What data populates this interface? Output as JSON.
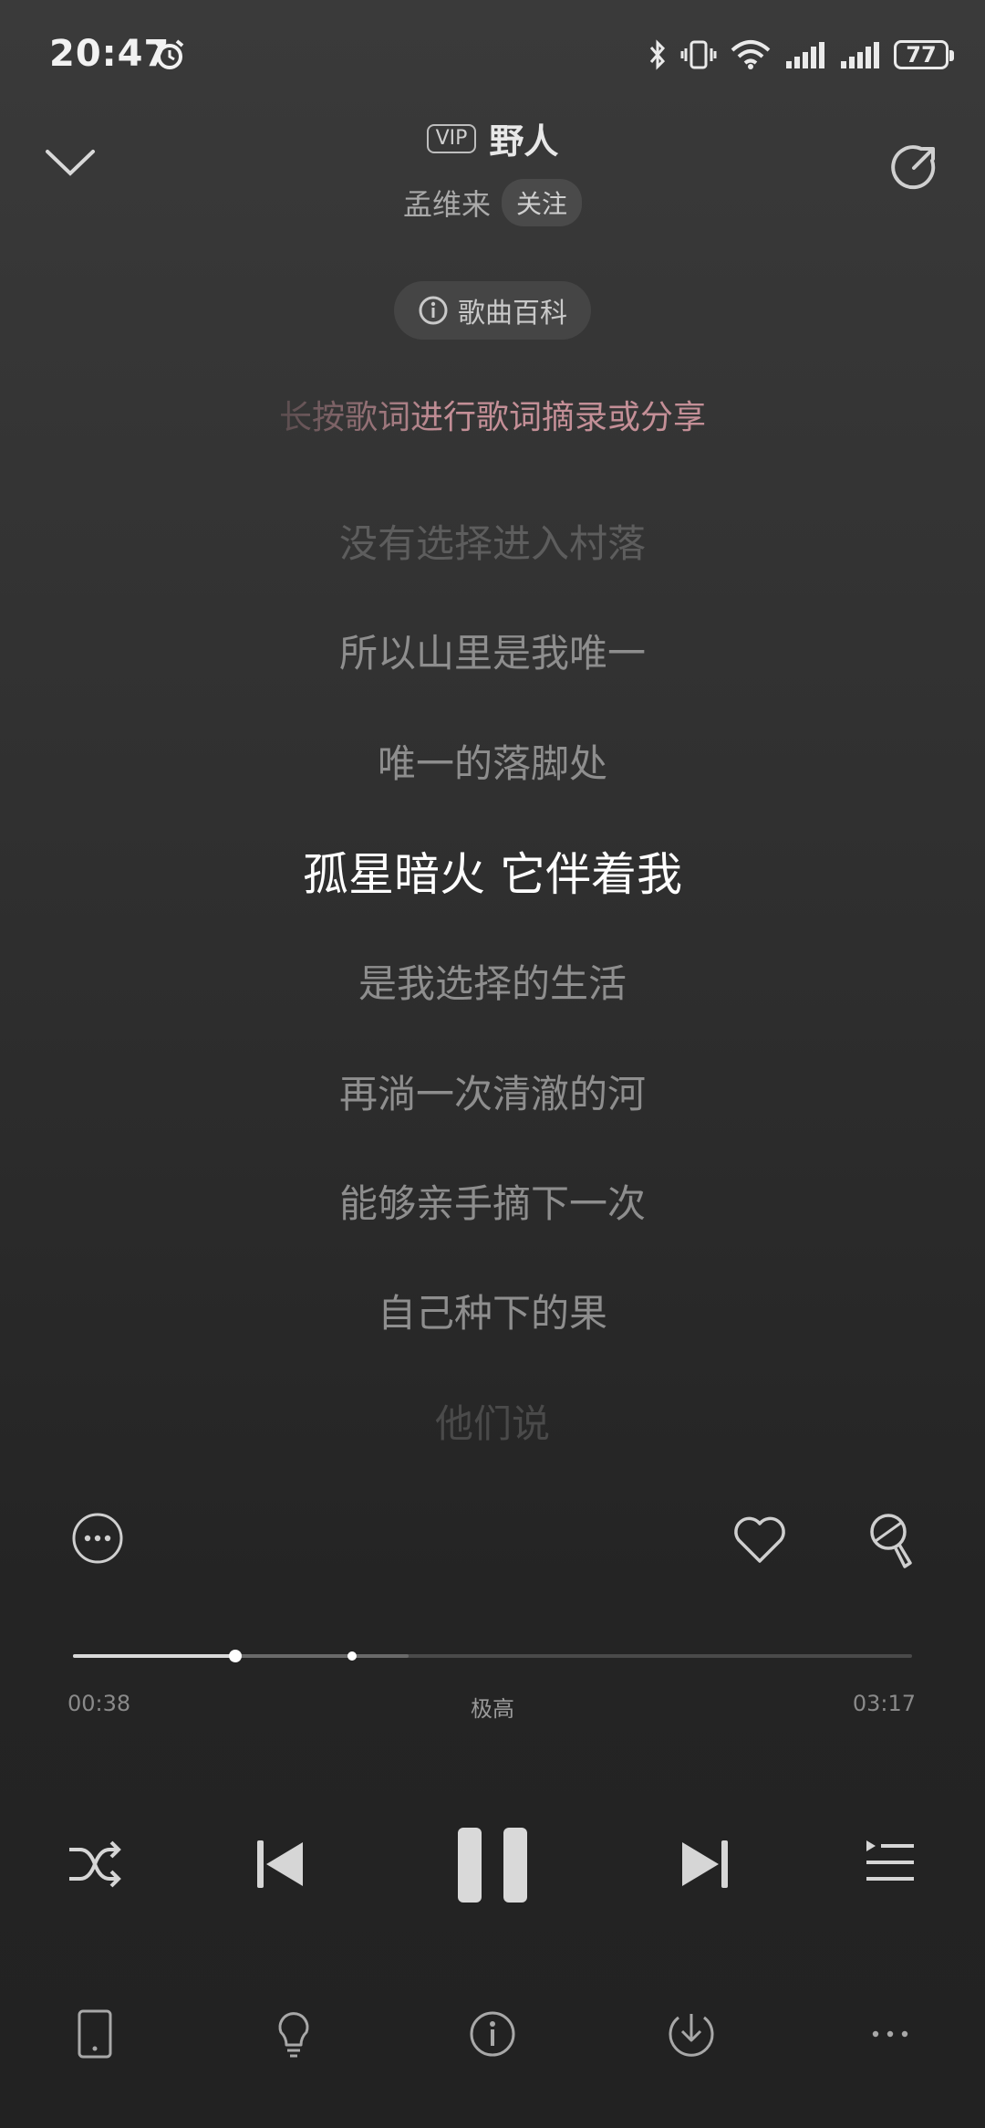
{
  "status_bar": {
    "time": "20:47",
    "battery": "77",
    "icons": [
      "alarm-icon",
      "bluetooth-icon",
      "vibrate-icon",
      "wifi-icon",
      "signal-icon",
      "signal-icon",
      "battery-icon"
    ]
  },
  "header": {
    "vip_badge": "VIP",
    "title": "野人",
    "artist": "孟维来",
    "follow_label": "关注",
    "wiki_label": "歌曲百科"
  },
  "hint": "长按歌词进行歌词摘录或分享",
  "lyrics": [
    {
      "text": "没有选择进入村落",
      "state": "faded"
    },
    {
      "text": "所以山里是我唯一",
      "state": "normal"
    },
    {
      "text": "唯一的落脚处",
      "state": "normal"
    },
    {
      "text": "孤星暗火 它伴着我",
      "state": "current"
    },
    {
      "text": "是我选择的生活",
      "state": "normal"
    },
    {
      "text": "再淌一次清澈的河",
      "state": "normal"
    },
    {
      "text": "能够亲手摘下一次",
      "state": "normal"
    },
    {
      "text": "自己种下的果",
      "state": "normal"
    },
    {
      "text": "他们说",
      "state": "faded"
    }
  ],
  "player": {
    "elapsed": "00:38",
    "total": "03:17",
    "quality": "极高",
    "progress_fraction": 0.193,
    "buffer_fraction": 0.4,
    "highlight_marker_fraction": 0.333
  },
  "colors": {
    "hint_accent": "#c48f97",
    "background_top": "#3a3a3a",
    "background_bottom": "#222222"
  }
}
